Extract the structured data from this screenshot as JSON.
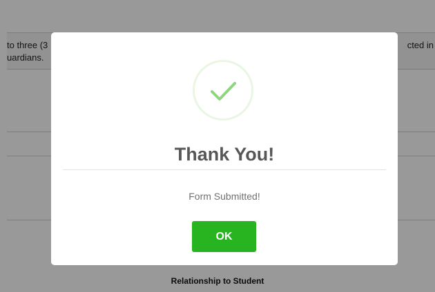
{
  "background": {
    "notice_line1_left": "to three (3",
    "notice_line2_left": "uardians.",
    "notice_line1_right": "cted in",
    "bottom_label": "Relationship to Student"
  },
  "modal": {
    "icon": "checkmark-icon",
    "title": "Thank You!",
    "message": "Form Submitted!",
    "ok_label": "OK"
  },
  "colors": {
    "accent": "#28b421",
    "check": "#8fd47f",
    "title": "#575757"
  }
}
